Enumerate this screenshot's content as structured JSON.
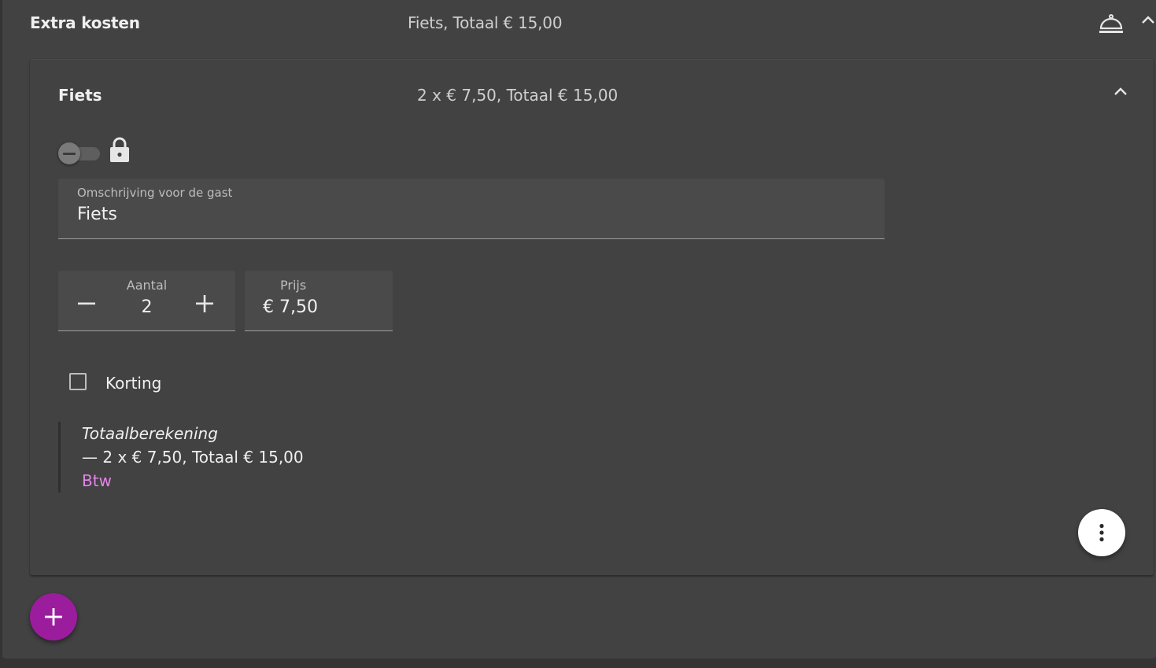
{
  "extra_costs": {
    "title": "Extra kosten",
    "summary": "Fiets, Totaal € 15,00",
    "service_icon": "room-service-icon",
    "collapse_icon": "chevron-up-icon"
  },
  "item": {
    "title": "Fiets",
    "summary": "2 x € 7,50, Totaal € 15,00",
    "collapse_icon": "chevron-up-icon",
    "toggle_state": "indeterminate",
    "lock_icon": "lock-icon",
    "description": {
      "label": "Omschrijving voor de gast",
      "value": "Fiets"
    },
    "quantity": {
      "label": "Aantal",
      "value": "2",
      "decrement_icon": "minus-icon",
      "increment_icon": "plus-icon"
    },
    "price": {
      "label": "Prijs",
      "value": "€ 7,50"
    },
    "discount": {
      "label": "Korting",
      "checked": false
    },
    "total_calc": {
      "title": "Totaalberekening",
      "line": "—  2 x € 7,50, Totaal € 15,00",
      "btw": "Btw"
    },
    "more_icon": "more-vertical-icon"
  },
  "add_button": {
    "icon": "plus-icon"
  },
  "colors": {
    "accent": "#9c1c9e",
    "btw_link": "#e684ea",
    "panel": "#424242",
    "field": "#4a4a4a"
  }
}
